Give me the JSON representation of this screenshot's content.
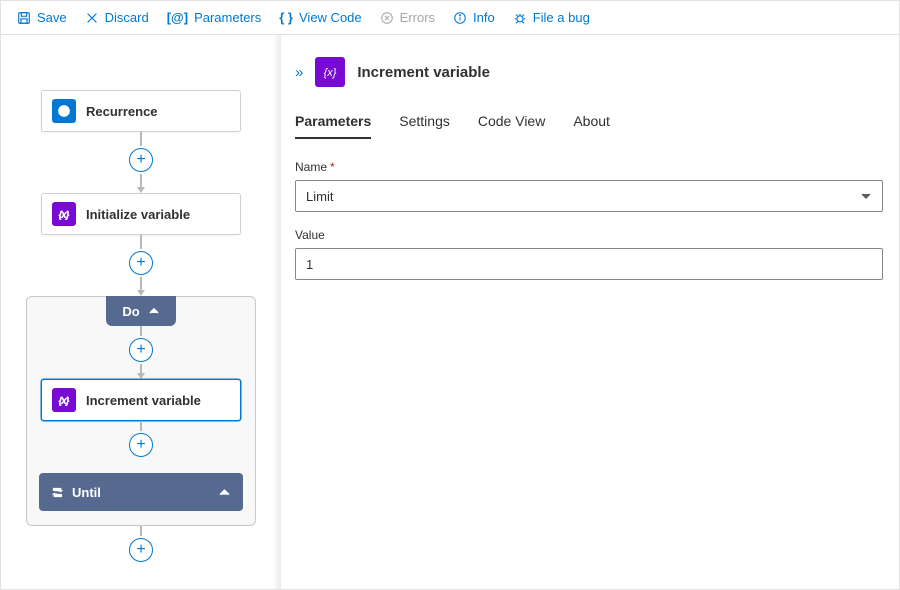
{
  "toolbar": {
    "save": "Save",
    "discard": "Discard",
    "parameters": "Parameters",
    "view_code": "View Code",
    "errors": "Errors",
    "info": "Info",
    "file_bug": "File a bug"
  },
  "workflow": {
    "recurrence": {
      "label": "Recurrence",
      "icon": "clock-icon",
      "color": "#0078d4"
    },
    "initialize": {
      "label": "Initialize variable",
      "icon": "variable-icon",
      "color": "#770bd4"
    },
    "loop_do_label": "Do",
    "increment": {
      "label": "Increment variable",
      "icon": "variable-icon",
      "color": "#770bd4",
      "selected": true
    },
    "loop_until_label": "Until"
  },
  "panel": {
    "title": "Increment variable",
    "icon_color": "#770bd4",
    "tabs": [
      "Parameters",
      "Settings",
      "Code View",
      "About"
    ],
    "active_tab": "Parameters",
    "fields": {
      "name": {
        "label": "Name",
        "required": true,
        "value": "Limit"
      },
      "value": {
        "label": "Value",
        "required": false,
        "value": "1"
      }
    }
  }
}
